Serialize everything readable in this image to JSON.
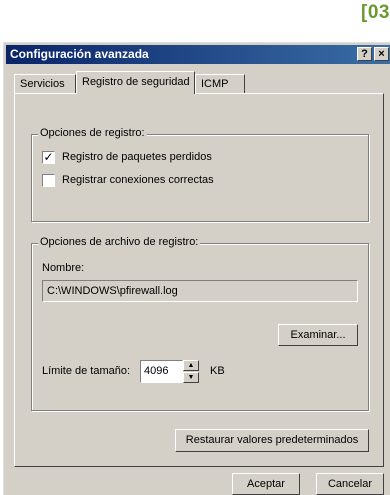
{
  "page_tag": "[03",
  "window": {
    "title": "Configuración avanzada",
    "help_label": "?",
    "close_label": "×"
  },
  "tabs": [
    {
      "label": "Servicios",
      "active": false
    },
    {
      "label": "Registro de seguridad",
      "active": true
    },
    {
      "label": "ICMP",
      "active": false
    }
  ],
  "logging_options": {
    "legend": "Opciones de registro:",
    "items": [
      {
        "label": "Registro de paquetes perdidos",
        "checked": true,
        "mark": "✓"
      },
      {
        "label": "Registrar conexiones correctas",
        "checked": false,
        "mark": ""
      }
    ]
  },
  "log_file": {
    "legend": "Opciones de archivo de registro:",
    "name_label": "Nombre:",
    "name_value": "C:\\WINDOWS\\pfirewall.log",
    "browse_label": "Examinar...",
    "size_label": "Límite de tamaño:",
    "size_value": "4096",
    "size_unit": "KB",
    "spin_up": "▲",
    "spin_down": "▼"
  },
  "restore_label": "Restaurar valores predeterminados",
  "footer": {
    "accept_label": "Aceptar",
    "cancel_label": "Cancelar"
  },
  "colors": {
    "title_start": "#0a246a",
    "title_end": "#3a6ea5",
    "face": "#d4d0c8",
    "page_tag": "#6a9a2f"
  }
}
